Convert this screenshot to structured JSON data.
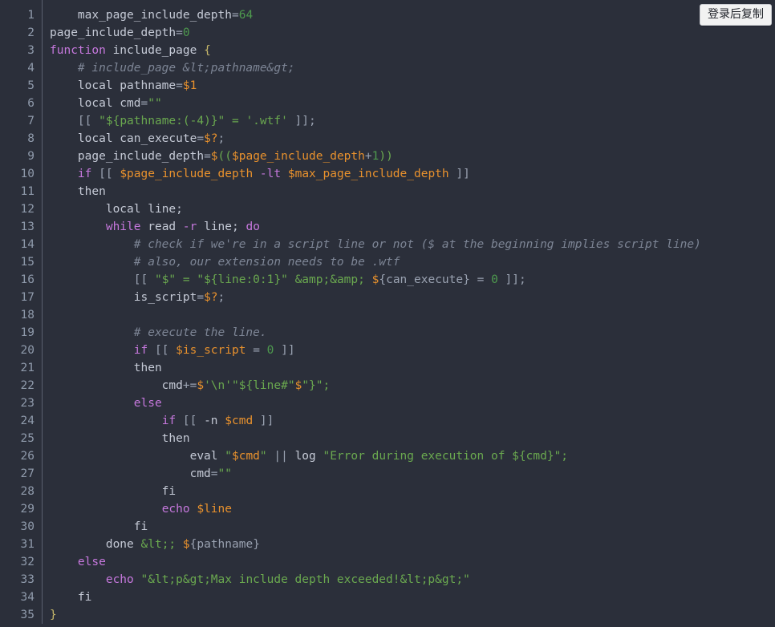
{
  "widget": {
    "name": "code-snippet-viewer",
    "language": "bash",
    "background_color": "#2b2f3a",
    "gutter_color": "#8f9aab",
    "divider_color": "#5a6070"
  },
  "copy_button": {
    "label": "登录后复制",
    "name": "copy-after-login-button",
    "background_color": "#f2f2f2",
    "text_color": "#20232a"
  },
  "colors": {
    "keyword": "#c678dd",
    "string": "#6aa84f",
    "number": "#4e9a4e",
    "variable": "#e8912d",
    "comment": "#7d8595",
    "brace": "#c8b96a",
    "plain": "#c5cad6",
    "punctuation": "#9aa2b1"
  },
  "first_line_number": 1,
  "line_count": 35,
  "line_numbers": [
    "1",
    "2",
    "3",
    "4",
    "5",
    "6",
    "7",
    "8",
    "9",
    "10",
    "11",
    "12",
    "13",
    "14",
    "15",
    "16",
    "17",
    "18",
    "19",
    "20",
    "21",
    "22",
    "23",
    "24",
    "25",
    "26",
    "27",
    "28",
    "29",
    "30",
    "31",
    "32",
    "33",
    "34",
    "35"
  ],
  "lines": [
    {
      "n": "1",
      "text": "max_page_include_depth=64"
    },
    {
      "n": "2",
      "text": "page_include_depth=0"
    },
    {
      "n": "3",
      "text": "function include_page {"
    },
    {
      "n": "4",
      "text": "    # include_page &lt;pathname&gt;"
    },
    {
      "n": "5",
      "text": "    local pathname=$1"
    },
    {
      "n": "6",
      "text": "    local cmd=\"\""
    },
    {
      "n": "7",
      "text": "    [[ \"${pathname:(-4)}\" = '.wtf' ]];"
    },
    {
      "n": "8",
      "text": "    local can_execute=$?;"
    },
    {
      "n": "9",
      "text": "    page_include_depth=$(($page_include_depth+1))"
    },
    {
      "n": "10",
      "text": "    if [[ $page_include_depth -lt $max_page_include_depth ]]"
    },
    {
      "n": "11",
      "text": "    then"
    },
    {
      "n": "12",
      "text": "        local line;"
    },
    {
      "n": "13",
      "text": "        while read -r line; do"
    },
    {
      "n": "14",
      "text": "            # check if we're in a script line or not ($ at the beginning implies script line)"
    },
    {
      "n": "15",
      "text": "            # also, our extension needs to be .wtf"
    },
    {
      "n": "16",
      "text": "            [[ \"$\" = \"${line:0:1}\" &amp;&amp; ${can_execute} = 0 ]];"
    },
    {
      "n": "17",
      "text": "            is_script=$?;"
    },
    {
      "n": "18",
      "text": ""
    },
    {
      "n": "19",
      "text": "            # execute the line."
    },
    {
      "n": "20",
      "text": "            if [[ $is_script = 0 ]]"
    },
    {
      "n": "21",
      "text": "            then"
    },
    {
      "n": "22",
      "text": "                cmd+=$'\\n'\"${line#\"$\"}\";"
    },
    {
      "n": "23",
      "text": "            else"
    },
    {
      "n": "24",
      "text": "                if [[ -n $cmd ]]"
    },
    {
      "n": "25",
      "text": "                then"
    },
    {
      "n": "26",
      "text": "                    eval \"$cmd\" || log \"Error during execution of ${cmd}\";"
    },
    {
      "n": "27",
      "text": "                    cmd=\"\""
    },
    {
      "n": "28",
      "text": "                fi"
    },
    {
      "n": "29",
      "text": "                echo $line"
    },
    {
      "n": "30",
      "text": "            fi"
    },
    {
      "n": "31",
      "text": "        done &lt; ${pathname}"
    },
    {
      "n": "32",
      "text": "    else"
    },
    {
      "n": "33",
      "text": "        echo \"&lt;p&gt;Max include depth exceeded!&lt;p&gt;\""
    },
    {
      "n": "34",
      "text": "    fi"
    },
    {
      "n": "35",
      "text": "}"
    }
  ],
  "tokens": [
    [
      [
        "    ",
        "plain"
      ],
      [
        "max_page_include_depth",
        "plain"
      ],
      [
        "=",
        "op"
      ],
      [
        "64",
        "num"
      ]
    ],
    [
      [
        "page_include_depth",
        "plain"
      ],
      [
        "=",
        "op"
      ],
      [
        "0",
        "num"
      ]
    ],
    [
      [
        "function",
        "kw"
      ],
      [
        " include_page ",
        "fn"
      ],
      [
        "{",
        "brace"
      ]
    ],
    [
      [
        "    # include_page &lt;pathname&gt;",
        "com"
      ]
    ],
    [
      [
        "    ",
        "plain"
      ],
      [
        "local",
        "plain"
      ],
      [
        " pathname",
        "plain"
      ],
      [
        "=",
        "op"
      ],
      [
        "$1",
        "var"
      ]
    ],
    [
      [
        "    ",
        "plain"
      ],
      [
        "local",
        "plain"
      ],
      [
        " cmd",
        "plain"
      ],
      [
        "=",
        "op"
      ],
      [
        "\"\"",
        "str"
      ]
    ],
    [
      [
        "    ",
        "plain"
      ],
      [
        "[[ ",
        "punc"
      ],
      [
        "\"${pathname:(-4)}\" = '.wtf'",
        "str"
      ],
      [
        " ]];",
        "punc"
      ]
    ],
    [
      [
        "    ",
        "plain"
      ],
      [
        "local",
        "plain"
      ],
      [
        " can_execute",
        "plain"
      ],
      [
        "=",
        "op"
      ],
      [
        "$?",
        "var"
      ],
      [
        ";",
        "punc"
      ]
    ],
    [
      [
        "    ",
        "plain"
      ],
      [
        "page_include_depth",
        "plain"
      ],
      [
        "=",
        "op"
      ],
      [
        "$",
        "sigil"
      ],
      [
        "((",
        "str"
      ],
      [
        "$page_include_depth",
        "var"
      ],
      [
        "+",
        "op"
      ],
      [
        "1",
        "num"
      ],
      [
        "))",
        "str"
      ]
    ],
    [
      [
        "    ",
        "plain"
      ],
      [
        "if",
        "kw"
      ],
      [
        " [[ ",
        "punc"
      ],
      [
        "$page_include_depth",
        "var"
      ],
      [
        " ",
        "plain"
      ],
      [
        "-lt",
        "kw"
      ],
      [
        " ",
        "plain"
      ],
      [
        "$max_page_include_depth",
        "var"
      ],
      [
        " ]]",
        "punc"
      ]
    ],
    [
      [
        "    ",
        "plain"
      ],
      [
        "then",
        "plain"
      ]
    ],
    [
      [
        "        ",
        "plain"
      ],
      [
        "local",
        "plain"
      ],
      [
        " line;",
        "plain"
      ]
    ],
    [
      [
        "        ",
        "plain"
      ],
      [
        "while",
        "kw"
      ],
      [
        " read ",
        "plain"
      ],
      [
        "-r",
        "kw"
      ],
      [
        " line; ",
        "plain"
      ],
      [
        "do",
        "kw"
      ]
    ],
    [
      [
        "            # check if we're in a script line or not ($ at the beginning implies script line)",
        "com"
      ]
    ],
    [
      [
        "            # also, our extension needs to be .wtf",
        "com"
      ]
    ],
    [
      [
        "            ",
        "plain"
      ],
      [
        "[[ ",
        "punc"
      ],
      [
        "\"$\" = \"${line:0:1}\"",
        "str"
      ],
      [
        " ",
        "plain"
      ],
      [
        "&amp;&amp;",
        "str"
      ],
      [
        " ",
        "plain"
      ],
      [
        "$",
        "sigil"
      ],
      [
        "{can_execute}",
        "punc"
      ],
      [
        " = ",
        "op"
      ],
      [
        "0",
        "num"
      ],
      [
        " ]];",
        "punc"
      ]
    ],
    [
      [
        "            is_script",
        "plain"
      ],
      [
        "=",
        "op"
      ],
      [
        "$?",
        "var"
      ],
      [
        ";",
        "punc"
      ]
    ],
    [
      [
        "",
        "plain"
      ]
    ],
    [
      [
        "            # execute the line.",
        "com"
      ]
    ],
    [
      [
        "            ",
        "plain"
      ],
      [
        "if",
        "kw"
      ],
      [
        " [[ ",
        "punc"
      ],
      [
        "$is_script",
        "var"
      ],
      [
        " = ",
        "op"
      ],
      [
        "0",
        "num"
      ],
      [
        " ]]",
        "punc"
      ]
    ],
    [
      [
        "            then",
        "plain"
      ]
    ],
    [
      [
        "                cmd",
        "plain"
      ],
      [
        "+=",
        "op"
      ],
      [
        "$",
        "sigil"
      ],
      [
        "'\\n'",
        "str"
      ],
      [
        "\"${line#\"",
        "str"
      ],
      [
        "$",
        "sigil"
      ],
      [
        "\"}\";",
        "str"
      ]
    ],
    [
      [
        "            ",
        "plain"
      ],
      [
        "else",
        "kw"
      ]
    ],
    [
      [
        "                ",
        "plain"
      ],
      [
        "if",
        "kw"
      ],
      [
        " [[ ",
        "punc"
      ],
      [
        "-n",
        "plain"
      ],
      [
        " ",
        "plain"
      ],
      [
        "$cmd",
        "var"
      ],
      [
        " ]]",
        "punc"
      ]
    ],
    [
      [
        "                then",
        "plain"
      ]
    ],
    [
      [
        "                    eval ",
        "plain"
      ],
      [
        "\"",
        "str"
      ],
      [
        "$cmd",
        "var"
      ],
      [
        "\"",
        "str"
      ],
      [
        " || ",
        "op"
      ],
      [
        "log ",
        "plain"
      ],
      [
        "\"Error during execution of ${cmd}\";",
        "str"
      ]
    ],
    [
      [
        "                    cmd",
        "plain"
      ],
      [
        "=",
        "op"
      ],
      [
        "\"\"",
        "str"
      ]
    ],
    [
      [
        "                fi",
        "plain"
      ]
    ],
    [
      [
        "                ",
        "plain"
      ],
      [
        "echo",
        "kw"
      ],
      [
        " ",
        "plain"
      ],
      [
        "$line",
        "var"
      ]
    ],
    [
      [
        "            fi",
        "plain"
      ]
    ],
    [
      [
        "        done ",
        "plain"
      ],
      [
        "&lt;",
        "str"
      ],
      [
        "; ",
        "str"
      ],
      [
        "$",
        "sigil"
      ],
      [
        "{pathname}",
        "punc"
      ]
    ],
    [
      [
        "    ",
        "plain"
      ],
      [
        "else",
        "kw"
      ]
    ],
    [
      [
        "        ",
        "plain"
      ],
      [
        "echo",
        "kw"
      ],
      [
        " ",
        "plain"
      ],
      [
        "\"&lt;p&gt;Max include depth exceeded!&lt;p&gt;\"",
        "str"
      ]
    ],
    [
      [
        "    fi",
        "plain"
      ]
    ],
    [
      [
        "}",
        "brace"
      ]
    ]
  ]
}
